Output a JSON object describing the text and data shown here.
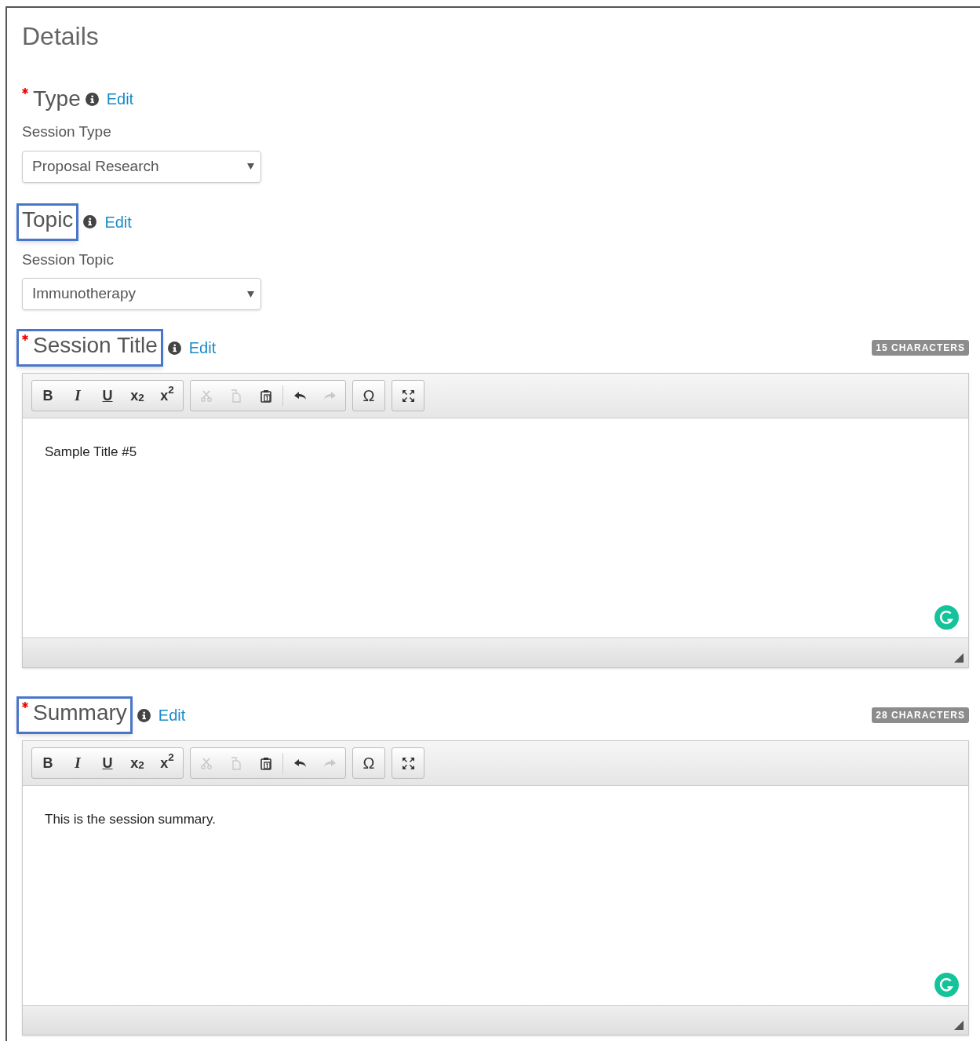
{
  "title": "Details",
  "sections": [
    {
      "kind": "select",
      "heading": "Type",
      "required": true,
      "highlighted": false,
      "edit": "Edit",
      "field_label": "Session Type",
      "value": "Proposal Research"
    },
    {
      "kind": "select",
      "heading": "Topic",
      "required": false,
      "highlighted": true,
      "edit": "Edit",
      "field_label": "Session Topic",
      "value": "Immunotherapy"
    },
    {
      "kind": "editor",
      "heading": "Session Title",
      "required": true,
      "highlighted": true,
      "edit": "Edit",
      "count": "15 CHARACTERS",
      "text": "Sample Title #5",
      "toolbar": [
        [
          {
            "kind": "bold",
            "label": "B",
            "disabled": false
          },
          {
            "kind": "italic",
            "label": "I",
            "disabled": false
          },
          {
            "kind": "underline",
            "label": "U",
            "disabled": false
          },
          {
            "kind": "subscript",
            "label": "x$_{2}$",
            "disabled": false
          },
          {
            "kind": "superscript",
            "label": "x$^{2}$",
            "disabled": false
          }
        ],
        [
          {
            "kind": "cut",
            "disabled": true
          },
          {
            "kind": "copy",
            "disabled": true
          },
          {
            "kind": "paste",
            "disabled": false
          },
          {
            "kind": "divider"
          },
          {
            "kind": "undo",
            "disabled": false
          },
          {
            "kind": "redo",
            "disabled": true
          }
        ],
        [
          {
            "kind": "symbol",
            "label": "Ω",
            "disabled": false
          }
        ],
        [
          {
            "kind": "maximize",
            "disabled": false
          }
        ]
      ]
    },
    {
      "kind": "editor",
      "heading": "Summary",
      "required": true,
      "highlighted": true,
      "edit": "Edit",
      "count": "28 CHARACTERS",
      "text": "This is the session summary.",
      "toolbar": [
        [
          {
            "kind": "bold",
            "label": "B",
            "disabled": false
          },
          {
            "kind": "italic",
            "label": "I",
            "disabled": false
          },
          {
            "kind": "underline",
            "label": "U",
            "disabled": false
          },
          {
            "kind": "subscript",
            "label": "x$_{2}$",
            "disabled": false
          },
          {
            "kind": "superscript",
            "label": "x$^{2}$",
            "disabled": false
          }
        ],
        [
          {
            "kind": "cut",
            "disabled": true
          },
          {
            "kind": "copy",
            "disabled": true
          },
          {
            "kind": "paste",
            "disabled": false
          },
          {
            "kind": "divider"
          },
          {
            "kind": "undo",
            "disabled": false
          },
          {
            "kind": "redo",
            "disabled": true
          }
        ],
        [
          {
            "kind": "symbol",
            "label": "Ω",
            "disabled": false
          }
        ],
        [
          {
            "kind": "maximize",
            "disabled": false
          }
        ]
      ]
    }
  ]
}
